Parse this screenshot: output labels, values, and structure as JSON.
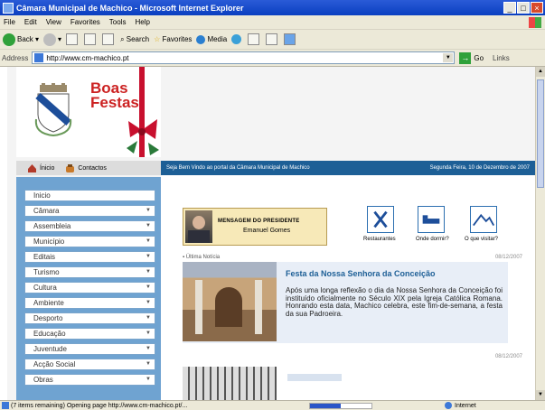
{
  "window": {
    "title": "Câmara Municipal de Machico - Microsoft Internet Explorer"
  },
  "menubar": [
    "File",
    "Edit",
    "View",
    "Favorites",
    "Tools",
    "Help"
  ],
  "toolbar": {
    "back": "Back",
    "search": "Search",
    "favorites": "Favorites",
    "media": "Media"
  },
  "address": {
    "label": "Address",
    "url": "http://www.cm-machico.pt",
    "go": "Go",
    "links": "Links"
  },
  "header": {
    "greeting_line1": "Boas",
    "greeting_line2": "Festas"
  },
  "topnav": {
    "inicio_short": "Ínicio",
    "contactos": "Contactos"
  },
  "bluebar": {
    "welcome": "Seja Bem Vindo ao portal da Câmara Municipal de Machico",
    "date": "Segunda Feira, 10 de Dezembro de 2007"
  },
  "sidemenu": [
    {
      "label": "Inicio",
      "chevron": false
    },
    {
      "label": "Câmara",
      "chevron": true
    },
    {
      "label": "Assembleia",
      "chevron": true
    },
    {
      "label": "Município",
      "chevron": true
    },
    {
      "label": "Editais",
      "chevron": true
    },
    {
      "label": "Turismo",
      "chevron": true
    },
    {
      "label": "Cultura",
      "chevron": true
    },
    {
      "label": "Ambiente",
      "chevron": true
    },
    {
      "label": "Desporto",
      "chevron": true
    },
    {
      "label": "Educação",
      "chevron": true
    },
    {
      "label": "Juventude",
      "chevron": true
    },
    {
      "label": "Acção Social",
      "chevron": true
    },
    {
      "label": "Obras",
      "chevron": true
    }
  ],
  "presidente": {
    "heading": "MENSAGEM DO PRESIDENTE",
    "name": "Emanuel Gomes"
  },
  "quicklinks": [
    {
      "label": "Restaurantes",
      "icon": "restaurant-icon"
    },
    {
      "label": "Onde dormir?",
      "icon": "bed-icon"
    },
    {
      "label": "O que visitar?",
      "icon": "landscape-icon"
    }
  ],
  "news": {
    "section": "Última Notícia",
    "date1": "08/12/2007",
    "title": "Festa da Nossa Senhora da Conceição",
    "text": "Após uma longa reflexão o dia da Nossa Senhora da Conceição foi instituído oficialmente no Século XIX pela Igreja Católica Romana. Honrando esta data, Machico celebra, este fim-de-semana, a festa da sua Padroeira.",
    "date2": "08/12/2007"
  },
  "status": {
    "text": "(7 items remaining) Opening page http://www.cm-machico.pt/...",
    "progress": 0.5,
    "zone": "Internet"
  },
  "colors": {
    "blue_bar": "#1d5f96",
    "menu_panel": "#6fa3d1",
    "news_title": "#1d5f96",
    "greeting": "#cc2222"
  }
}
